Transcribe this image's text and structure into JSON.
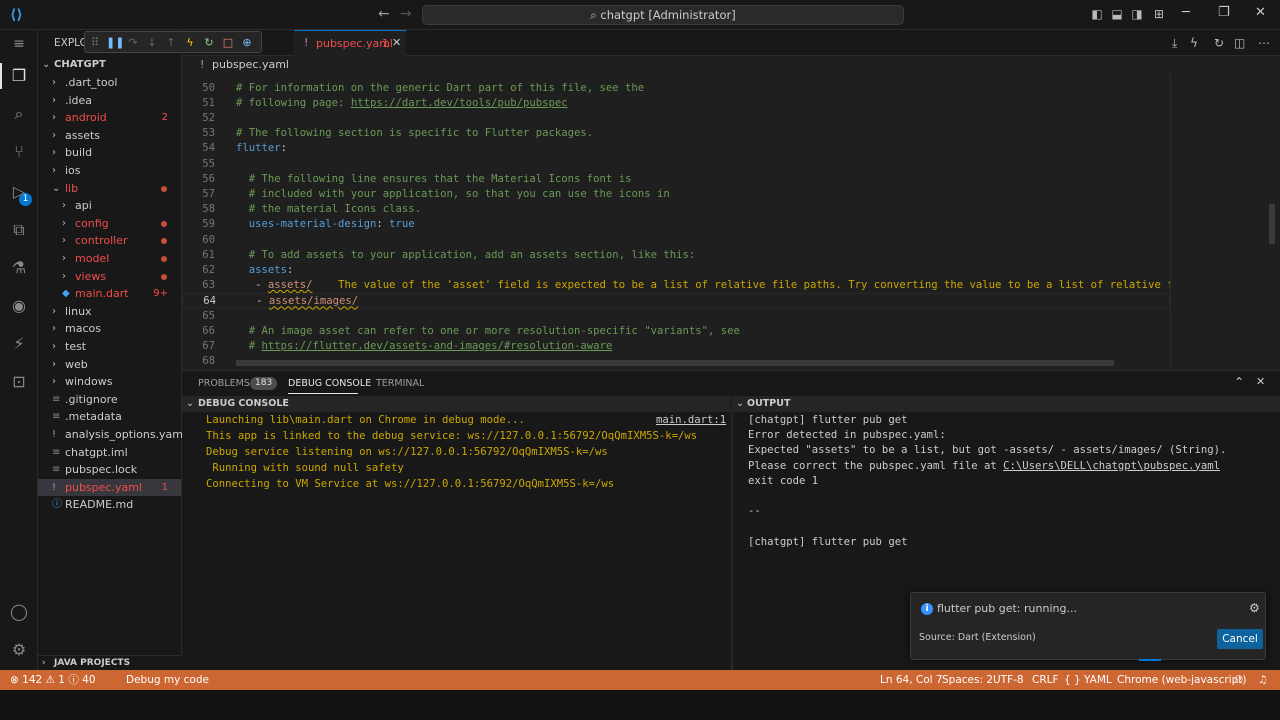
{
  "titlebar": {
    "search": "chatgpt [Administrator]"
  },
  "debug_toolbar": {
    "icons": [
      "grip-icon",
      "pause-icon",
      "step-over-icon",
      "step-into-icon",
      "step-out-icon",
      "hot-reload-icon",
      "restart-icon",
      "stop-icon",
      "devtools-icon"
    ]
  },
  "sidebar": {
    "header": "EXPLO",
    "root": "CHATGPT",
    "items": [
      {
        "label": ".dart_tool",
        "indent": 1,
        "type": "folder",
        "color": "#cccccc"
      },
      {
        "label": ".idea",
        "indent": 1,
        "type": "folder",
        "color": "#cccccc"
      },
      {
        "label": "android",
        "indent": 1,
        "type": "folder",
        "color": "#f14c4c",
        "count": "2"
      },
      {
        "label": "assets",
        "indent": 1,
        "type": "folder",
        "color": "#cccccc"
      },
      {
        "label": "build",
        "indent": 1,
        "type": "folder",
        "color": "#cccccc"
      },
      {
        "label": "ios",
        "indent": 1,
        "type": "folder",
        "color": "#cccccc"
      },
      {
        "label": "lib",
        "indent": 1,
        "type": "folder-open",
        "color": "#f14c4c",
        "dot": true
      },
      {
        "label": "api",
        "indent": 2,
        "type": "folder",
        "color": "#cccccc"
      },
      {
        "label": "config",
        "indent": 2,
        "type": "folder",
        "color": "#f14c4c",
        "dot": true
      },
      {
        "label": "controller",
        "indent": 2,
        "type": "folder",
        "color": "#f14c4c",
        "dot": true
      },
      {
        "label": "model",
        "indent": 2,
        "type": "folder",
        "color": "#f14c4c",
        "dot": true
      },
      {
        "label": "views",
        "indent": 2,
        "type": "folder",
        "color": "#f14c4c",
        "dot": true
      },
      {
        "label": "main.dart",
        "indent": 2,
        "type": "dart",
        "color": "#f14c4c",
        "count": "9+"
      },
      {
        "label": "linux",
        "indent": 1,
        "type": "folder",
        "color": "#cccccc"
      },
      {
        "label": "macos",
        "indent": 1,
        "type": "folder",
        "color": "#cccccc"
      },
      {
        "label": "test",
        "indent": 1,
        "type": "folder",
        "color": "#cccccc"
      },
      {
        "label": "web",
        "indent": 1,
        "type": "folder",
        "color": "#cccccc"
      },
      {
        "label": "windows",
        "indent": 1,
        "type": "folder",
        "color": "#cccccc"
      },
      {
        "label": ".gitignore",
        "indent": 1,
        "type": "file",
        "color": "#cccccc"
      },
      {
        "label": ".metadata",
        "indent": 1,
        "type": "file",
        "color": "#cccccc"
      },
      {
        "label": "analysis_options.yaml",
        "indent": 1,
        "type": "yaml",
        "color": "#cccccc"
      },
      {
        "label": "chatgpt.iml",
        "indent": 1,
        "type": "file",
        "color": "#cccccc"
      },
      {
        "label": "pubspec.lock",
        "indent": 1,
        "type": "file",
        "color": "#cccccc"
      },
      {
        "label": "pubspec.yaml",
        "indent": 1,
        "type": "yaml",
        "color": "#f14c4c",
        "count": "1",
        "selected": true
      },
      {
        "label": "README.md",
        "indent": 1,
        "type": "md",
        "color": "#cccccc"
      }
    ],
    "java_projects": "JAVA PROJECTS"
  },
  "editor": {
    "tab_label": "pubspec.yaml",
    "tab_count": "1",
    "breadcrumb": "pubspec.yaml",
    "lines": [
      {
        "n": "50",
        "parts": [
          [
            "c-com",
            "# For information on the generic Dart part of this file, see the"
          ]
        ]
      },
      {
        "n": "51",
        "parts": [
          [
            "c-com",
            "# following page: "
          ],
          [
            "c-link",
            "https://dart.dev/tools/pub/pubspec"
          ]
        ]
      },
      {
        "n": "52",
        "parts": []
      },
      {
        "n": "53",
        "parts": [
          [
            "c-com",
            "# The following section is specific to Flutter packages."
          ]
        ]
      },
      {
        "n": "54",
        "parts": [
          [
            "c-key",
            "flutter"
          ],
          [
            "",
            ":"
          ]
        ]
      },
      {
        "n": "55",
        "parts": []
      },
      {
        "n": "56",
        "parts": [
          [
            "",
            "  "
          ],
          [
            "c-com",
            "# The following line ensures that the Material Icons font is"
          ]
        ]
      },
      {
        "n": "57",
        "parts": [
          [
            "",
            "  "
          ],
          [
            "c-com",
            "# included with your application, so that you can use the icons in"
          ]
        ]
      },
      {
        "n": "58",
        "parts": [
          [
            "",
            "  "
          ],
          [
            "c-com",
            "# the material Icons class."
          ]
        ]
      },
      {
        "n": "59",
        "parts": [
          [
            "",
            "  "
          ],
          [
            "c-key",
            "uses-material-design"
          ],
          [
            "",
            ": "
          ],
          [
            "c-val",
            "true"
          ]
        ]
      },
      {
        "n": "60",
        "parts": []
      },
      {
        "n": "61",
        "parts": [
          [
            "",
            "  "
          ],
          [
            "c-com",
            "# To add assets to your application, add an assets section, like this:"
          ]
        ]
      },
      {
        "n": "62",
        "parts": [
          [
            "",
            "  "
          ],
          [
            "c-key",
            "assets"
          ],
          [
            "",
            ":"
          ]
        ]
      },
      {
        "n": "63",
        "parts": [
          [
            "",
            "   - "
          ],
          [
            "c-txt squig",
            "assets/"
          ],
          [
            "",
            "    "
          ],
          [
            "err-inline",
            "The value of the 'asset' field is expected to be a list of relative file paths. Try converting the value to be a list of relative file"
          ]
        ]
      },
      {
        "n": "64",
        "current": true,
        "parts": [
          [
            "",
            "   - "
          ],
          [
            "c-txt squig",
            "assets/images/"
          ]
        ]
      },
      {
        "n": "65",
        "parts": []
      },
      {
        "n": "66",
        "parts": [
          [
            "",
            "  "
          ],
          [
            "c-com",
            "# An image asset can refer to one or more resolution-specific \"variants\", see"
          ]
        ]
      },
      {
        "n": "67",
        "parts": [
          [
            "",
            "  "
          ],
          [
            "c-com",
            "# "
          ],
          [
            "c-link",
            "https://flutter.dev/assets-and-images/#resolution-aware"
          ]
        ]
      },
      {
        "n": "68",
        "parts": []
      }
    ]
  },
  "panel": {
    "tabs": [
      "PROBLEMS",
      "DEBUG CONSOLE",
      "TERMINAL"
    ],
    "problems_count": "183",
    "debug_console_header": "DEBUG CONSOLE",
    "output_header": "OUTPUT",
    "debug_console_lines": [
      "Launching lib\\main.dart on Chrome in debug mode...",
      "This app is linked to the debug service: ws://127.0.0.1:56792/OqQmIXM5S-k=/ws",
      "Debug service listening on ws://127.0.0.1:56792/OqQmIXM5S-k=/ws",
      " Running with sound null safety",
      "Connecting to VM Service at ws://127.0.0.1:56792/OqQmIXM5S-k=/ws"
    ],
    "debug_console_source": "main.dart:1",
    "output_lines": [
      "[chatgpt] flutter pub get",
      "Error detected in pubspec.yaml:",
      "Expected \"assets\" to be a list, but got -assets/ - assets/images/ (String).",
      "Please correct the pubspec.yaml file at ",
      "exit code 1",
      "",
      "--",
      "",
      "[chatgpt] flutter pub get"
    ],
    "output_path": "C:\\Users\\DELL\\chatgpt\\pubspec.yaml"
  },
  "notification": {
    "message": "flutter pub get: running...",
    "source": "Source: Dart (Extension)",
    "cancel": "Cancel"
  },
  "statusbar": {
    "errors": "142",
    "warnings": "1",
    "info": "40",
    "debug_label": "Debug my code",
    "position": "Ln 64, Col 7",
    "spaces": "Spaces: 2",
    "encoding": "UTF-8",
    "eol": "CRLF",
    "language": "YAML",
    "device": "Chrome (web-javascript)"
  },
  "colors": {
    "accent": "#0078d4",
    "statusbar": "#cc6633",
    "error": "#f14c4c",
    "warning": "#cca700"
  }
}
